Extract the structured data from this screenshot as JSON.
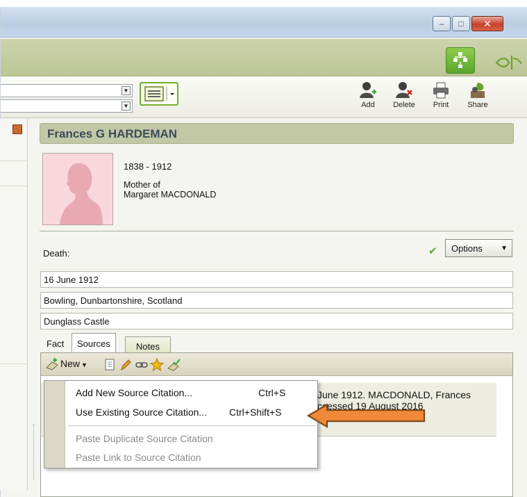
{
  "window": {
    "minimize_glyph": "–",
    "maximize_glyph": "□",
    "close_glyph": "✕"
  },
  "brand": {
    "tree_view_icon": "family-tree-icon",
    "logo_icon": "leaf-logo-icon"
  },
  "toolbar": {
    "add_label": "Add",
    "delete_label": "Delete",
    "print_label": "Print",
    "share_label": "Share"
  },
  "person": {
    "name": "Frances G HARDEMAN",
    "years": "1838 - 1912",
    "relation_line1": "Mother of",
    "relation_line2": "Margaret MACDONALD"
  },
  "fact": {
    "label": "Death:",
    "options_label": "Options",
    "date": "16 June 1912",
    "place": "Bowling, Dunbartonshire, Scotland",
    "description": "Dunglass Castle"
  },
  "tabs": {
    "fact": "Fact",
    "sources": "Sources",
    "notes": "Notes"
  },
  "sources": {
    "new_label": "New",
    "citation_line1": "June 1912. MACDONALD, Frances",
    "citation_line2": "ccessed 19 August 2016"
  },
  "context_menu": {
    "items": [
      {
        "label": "Add New Source Citation...",
        "shortcut": "Ctrl+S"
      },
      {
        "label": "Use Existing Source Citation...",
        "shortcut": "Ctrl+Shift+S"
      },
      {
        "label": "Paste Duplicate Source Citation",
        "shortcut": ""
      },
      {
        "label": "Paste Link to Source Citation",
        "shortcut": ""
      }
    ]
  },
  "colors": {
    "header_green": "#c2c7a6",
    "accent_green": "#6fae2b",
    "arrow_orange": "#f0893a"
  }
}
